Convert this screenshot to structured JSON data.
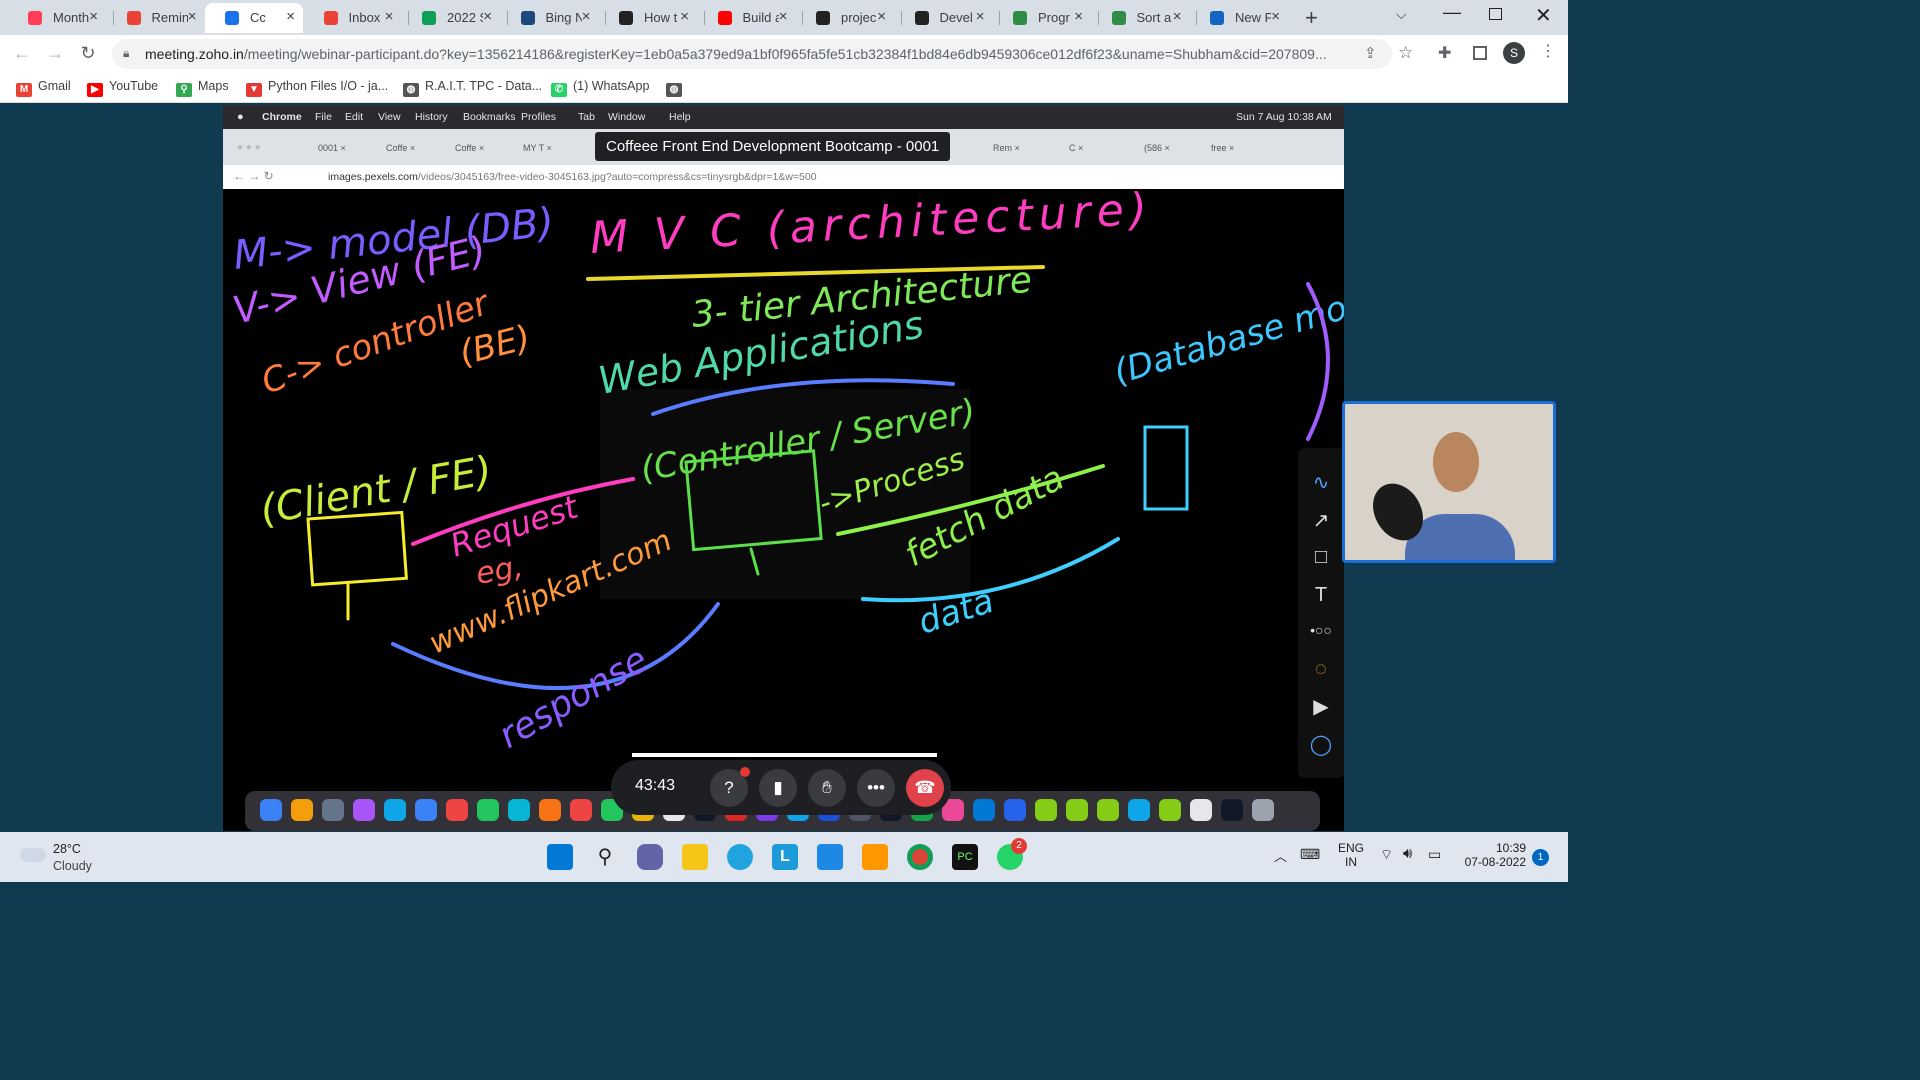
{
  "browser": {
    "tabs": [
      {
        "label": "Month",
        "icon": "monday-icon",
        "color": "#ff3d57"
      },
      {
        "label": "Remin",
        "icon": "gmail-icon",
        "color": "#ea4335"
      },
      {
        "label": "Cc",
        "icon": "zoho-icon",
        "color": "#1a73e8",
        "active": true
      },
      {
        "label": "Inbox",
        "icon": "gmail-icon",
        "color": "#ea4335"
      },
      {
        "label": "2022 S",
        "icon": "sheets-icon",
        "color": "#0f9d58"
      },
      {
        "label": "Bing N",
        "icon": "bing-icon",
        "color": "#1b4a7a"
      },
      {
        "label": "How t",
        "icon": "replit-icon",
        "color": "#222222"
      },
      {
        "label": "Build a",
        "icon": "youtube-icon",
        "color": "#ff0000"
      },
      {
        "label": "projec",
        "icon": "github-icon",
        "color": "#222222"
      },
      {
        "label": "Devel",
        "icon": "github-icon",
        "color": "#222222"
      },
      {
        "label": "Progr",
        "icon": "gfg-icon",
        "color": "#2f8d46"
      },
      {
        "label": "Sort a",
        "icon": "gfg-icon",
        "color": "#2f8d46"
      },
      {
        "label": "New F",
        "icon": "k-icon",
        "color": "#1565c0"
      }
    ],
    "url_host": "meeting.zoho.in",
    "url_path": "/meeting/webinar-participant.do?key=1356214186&registerKey=1eb0a5a379ed9a1bf0f965fa5fe51cb32384f1bd84e6db9459306ce012df6f23&uname=Shubham&cid=207809...",
    "profile_initial": "S",
    "bookmarks": [
      {
        "label": "Gmail",
        "color": "#ea4335",
        "glyph": "M"
      },
      {
        "label": "YouTube",
        "color": "#ff0000",
        "glyph": "▶"
      },
      {
        "label": "Maps",
        "color": "#34a853",
        "glyph": "⚲"
      },
      {
        "label": "Python Files I/O - ja...",
        "color": "#e53935",
        "glyph": "▼"
      },
      {
        "label": "R.A.I.T. TPC - Data...",
        "color": "#555555",
        "glyph": "◍"
      },
      {
        "label": "(1) WhatsApp",
        "color": "#25d366",
        "glyph": "✆"
      },
      {
        "label": "",
        "color": "#555555",
        "glyph": "◍"
      }
    ]
  },
  "share": {
    "mac_menu": [
      "Chrome",
      "File",
      "Edit",
      "View",
      "History",
      "Bookmarks",
      "Profiles",
      "Tab",
      "Window",
      "Help"
    ],
    "mac_clock": "Sun 7 Aug  10:38 AM",
    "inner_tabs": [
      "0001",
      "Coffe",
      "Coffe",
      "MY T",
      "Rem",
      "C",
      "(586",
      "free"
    ],
    "inner_url_host": "images.pexels.com",
    "inner_url_path": "/videos/3045163/free-video-3045163.jpg?auto=compress&cs=tinysrgb&dpr=1&w=500",
    "tooltip": "Coffeee Front End Development Bootcamp - 0001",
    "whiteboard": {
      "lines": [
        "M-> model (DB)",
        "V-> View (FE)",
        "C-> controller",
        "(BE)",
        "M V C (architecture)",
        "3- tier Architecture",
        "Web Applications",
        "(Database model)",
        "(Client / FE)",
        "(Controller / Server)",
        "->Process",
        "Request",
        "eg,",
        "www.flipkart.com",
        "fetch data",
        "data",
        "response"
      ]
    }
  },
  "meeting": {
    "timer": "43:43"
  },
  "taskbar": {
    "temperature": "28°C",
    "condition": "Cloudy",
    "lang_1": "ENG",
    "lang_2": "IN",
    "time": "10:39",
    "date": "07-08-2022",
    "notifications": "1",
    "whatsapp_badge": "2"
  }
}
